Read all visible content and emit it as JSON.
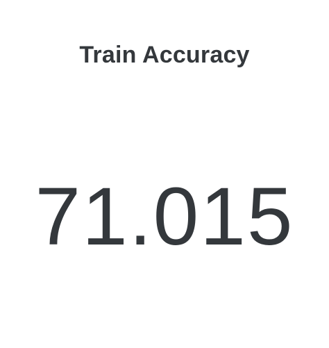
{
  "stat_panel": {
    "title": "Train Accuracy",
    "value": "71.015"
  },
  "colors": {
    "background": "#ffffff",
    "text": "#34383c"
  }
}
